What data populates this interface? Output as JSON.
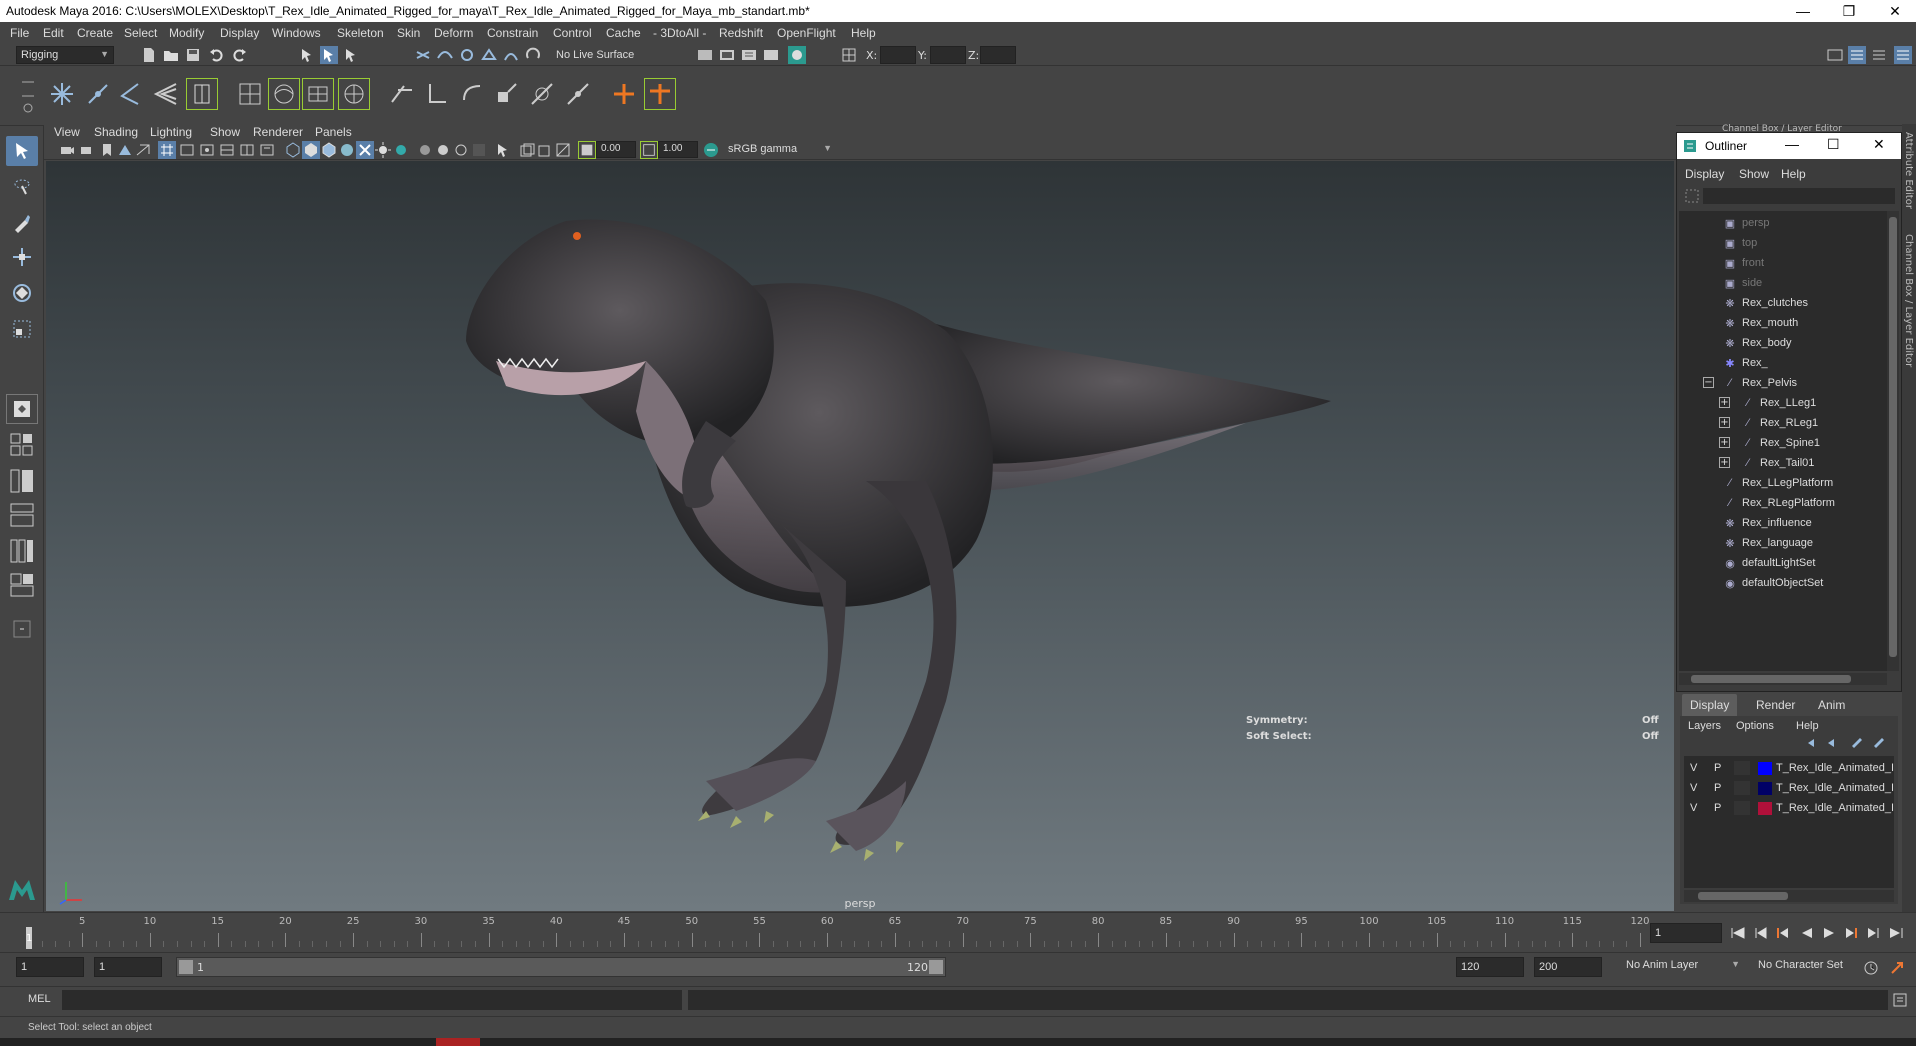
{
  "window": {
    "title": "Autodesk Maya 2016: C:\\Users\\MOLEX\\Desktop\\T_Rex_Idle_Animated_Rigged_for_maya\\T_Rex_Idle_Animated_Rigged_for_Maya_mb_standart.mb*"
  },
  "menubar": [
    "File",
    "Edit",
    "Create",
    "Select",
    "Modify",
    "Display",
    "Windows",
    "Skeleton",
    "Skin",
    "Deform",
    "Constrain",
    "Control",
    "Cache",
    "- 3DtoAll -",
    "Redshift",
    "OpenFlight",
    "Help"
  ],
  "statusline": {
    "mode": "Rigging",
    "live_surface": "No Live Surface",
    "x_label": "X:",
    "y_label": "Y:",
    "z_label": "Z:"
  },
  "viewport": {
    "menu": [
      "View",
      "Shading",
      "Lighting",
      "Show",
      "Renderer",
      "Panels"
    ],
    "exposure": "0.00",
    "gamma": "1.00",
    "color_space": "sRGB gamma",
    "camera_label": "persp",
    "hud": {
      "symmetry_label": "Symmetry:",
      "symmetry_value": "Off",
      "soft_select_label": "Soft Select:",
      "soft_select_value": "Off"
    }
  },
  "channel_box_header": "Channel Box / Layer Editor",
  "outliner": {
    "title": "Outliner",
    "menu": [
      "Display",
      "Show",
      "Help"
    ],
    "items": [
      {
        "label": "persp",
        "icon": "camera-icon",
        "dim": true
      },
      {
        "label": "top",
        "icon": "camera-icon",
        "dim": true
      },
      {
        "label": "front",
        "icon": "camera-icon",
        "dim": true
      },
      {
        "label": "side",
        "icon": "camera-icon",
        "dim": true
      },
      {
        "label": "Rex_clutches",
        "icon": "mesh-icon"
      },
      {
        "label": "Rex_mouth",
        "icon": "mesh-icon"
      },
      {
        "label": "Rex_body",
        "icon": "mesh-icon"
      },
      {
        "label": "Rex_",
        "icon": "locator-icon"
      },
      {
        "label": "Rex_Pelvis",
        "icon": "joint-icon"
      },
      {
        "label": "Rex_LLeg1",
        "icon": "joint-icon"
      },
      {
        "label": "Rex_RLeg1",
        "icon": "joint-icon"
      },
      {
        "label": "Rex_Spine1",
        "icon": "joint-icon"
      },
      {
        "label": "Rex_Tail01",
        "icon": "joint-icon"
      },
      {
        "label": "Rex_LLegPlatform",
        "icon": "joint-icon"
      },
      {
        "label": "Rex_RLegPlatform",
        "icon": "joint-icon"
      },
      {
        "label": "Rex_influence",
        "icon": "mesh-icon"
      },
      {
        "label": "Rex_language",
        "icon": "mesh-icon"
      },
      {
        "label": "defaultLightSet",
        "icon": "set-icon"
      },
      {
        "label": "defaultObjectSet",
        "icon": "set-icon"
      }
    ]
  },
  "layer_editor": {
    "tabs": [
      "Display",
      "Render",
      "Anim"
    ],
    "menu": [
      "Layers",
      "Options",
      "Help"
    ],
    "layers": [
      {
        "v": "V",
        "p": "P",
        "name": "T_Rex_Idle_Animated_I",
        "color": "#0000ff"
      },
      {
        "v": "V",
        "p": "P",
        "name": "T_Rex_Idle_Animated_I",
        "color": "#000066"
      },
      {
        "v": "V",
        "p": "P",
        "name": "T_Rex_Idle_Animated_I",
        "color": "#b0103a"
      }
    ]
  },
  "side_tabs": {
    "attribute_editor": "Attribute Editor",
    "channel_box": "Channel Box / Layer Editor"
  },
  "timeslider": {
    "ticks": [
      "5",
      "10",
      "15",
      "20",
      "25",
      "30",
      "35",
      "40",
      "45",
      "50",
      "55",
      "60",
      "65",
      "70",
      "75",
      "80",
      "85",
      "90",
      "95",
      "100",
      "105",
      "110",
      "115",
      "120"
    ],
    "current_frame_marker": "1",
    "current_frame_field": "1"
  },
  "rangebar": {
    "start_field": "1",
    "range_start_field": "1",
    "range_slider_start": "1",
    "range_slider_end": "120",
    "range_end_field": "120",
    "end_field": "200",
    "anim_layer": "No Anim Layer",
    "character_set": "No Character Set"
  },
  "mel": {
    "label": "MEL"
  },
  "helpline": {
    "text": "Select Tool: select an object"
  }
}
